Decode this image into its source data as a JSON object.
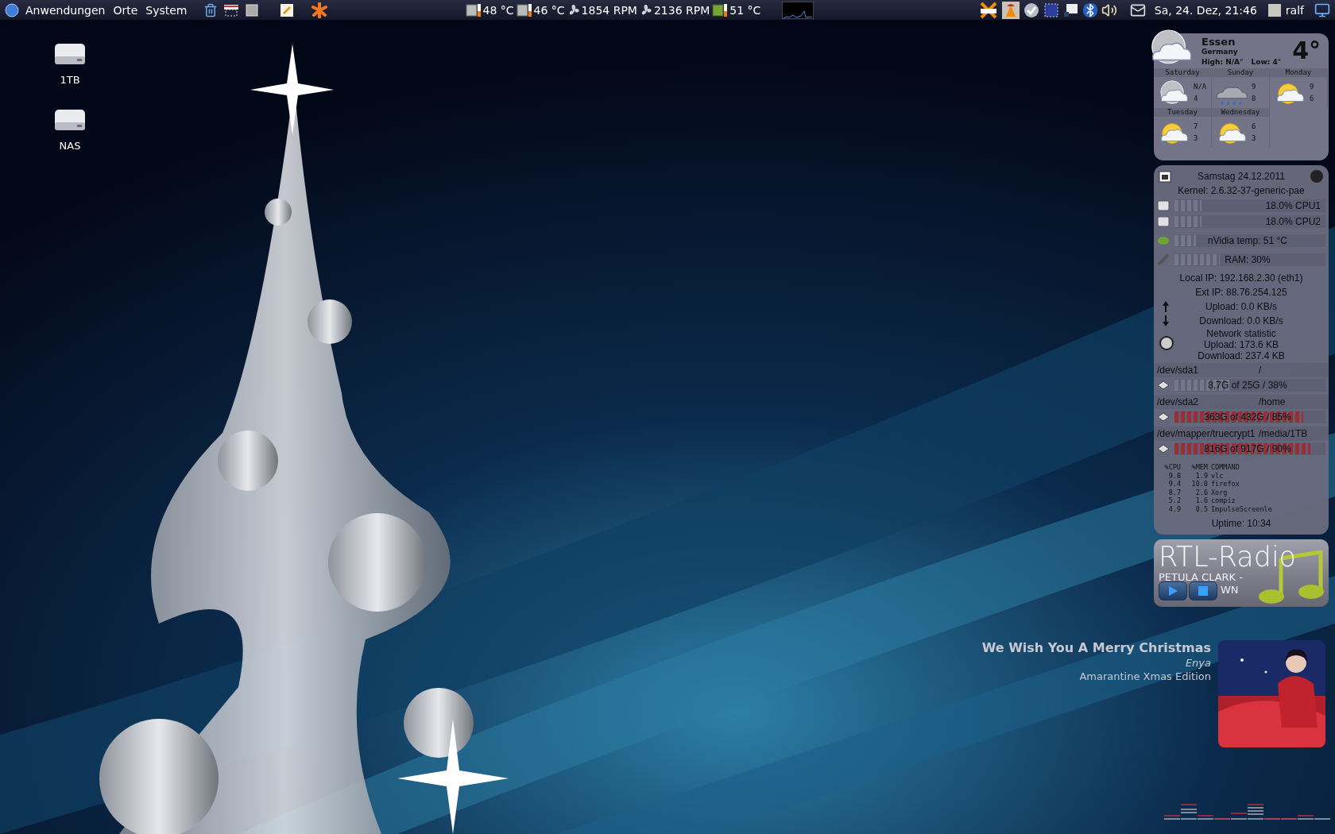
{
  "top_panel": {
    "menus": [
      "Anwendungen",
      "Orte",
      "System"
    ],
    "sensors": [
      {
        "kind": "chip",
        "reading": "48 °C"
      },
      {
        "kind": "chip",
        "reading": "46 °C"
      },
      {
        "kind": "fan",
        "reading": "1854 RPM"
      },
      {
        "kind": "fan",
        "reading": "2136 RPM"
      },
      {
        "kind": "gpu",
        "reading": "51 °C"
      }
    ],
    "clock": "Sa, 24. Dez, 21:46",
    "user": "ralf"
  },
  "desktop_icons": [
    "1TB",
    "NAS"
  ],
  "weather": {
    "city": "Essen",
    "country": "Germany",
    "high": "High: N/A°",
    "low": "Low: 4°",
    "temperature": "4°",
    "forecast": [
      {
        "day": "Saturday",
        "kind": "night",
        "high": "N/A",
        "low": "4"
      },
      {
        "day": "Sunday",
        "kind": "rain",
        "high": "9",
        "low": "8"
      },
      {
        "day": "Monday",
        "kind": "sun",
        "high": "9",
        "low": "6"
      },
      {
        "day": "Tuesday",
        "kind": "sun",
        "high": "7",
        "low": "3"
      },
      {
        "day": "Wednesday",
        "kind": "sun",
        "high": "6",
        "low": "3"
      }
    ]
  },
  "system_monitor": {
    "date": "Samstag 24.12.2011",
    "kernel": "Kernel: 2.6.32-37-generic-pae",
    "bars": [
      {
        "kind": "cpu",
        "label": "18.0% CPU1",
        "level": 0.18
      },
      {
        "kind": "cpu",
        "label": "18.0% CPU2",
        "level": 0.18
      },
      {
        "kind": "gpu",
        "label": "nVidia temp: 51 °C",
        "level": 0.14
      },
      {
        "kind": "ram",
        "label": "RAM: 30%",
        "level": 0.3
      }
    ],
    "local_ip": "Local IP: 192.168.2.30 (eth1)",
    "ext_ip": "Ext IP: 88.76.254.125",
    "upload": "Upload: 0.0 KB/s",
    "download": "Download: 0.0 KB/s",
    "statistic": [
      "Network statistic",
      "Upload: 173.6 KB",
      "Download: 237.4 KB"
    ],
    "disks": [
      {
        "device": "/dev/sda1",
        "mount": "/",
        "usage": "8,7G of 25G / 38%",
        "level": 0.38,
        "full": false
      },
      {
        "device": "/dev/sda2",
        "mount": "/home",
        "usage": "363G of 432G / 85%",
        "level": 0.85,
        "full": true
      },
      {
        "device": "/dev/mapper/truecrypt1",
        "mount": "/media/1TB",
        "usage": "816G of 917G / 90%",
        "level": 0.9,
        "full": true
      }
    ],
    "process_columns": [
      "%CPU",
      "%MEM",
      "COMMAND"
    ],
    "processes": [
      [
        "9.8",
        "1.9",
        "vlc"
      ],
      [
        "9.4",
        "10.0",
        "firefox"
      ],
      [
        "8.7",
        "2.6",
        "Xorg"
      ],
      [
        "5.2",
        "1.6",
        "compiz"
      ],
      [
        "4.9",
        "0.5",
        "ImpulseScreenle"
      ]
    ],
    "uptime": "Uptime: 10:34"
  },
  "radio": {
    "station": "RTL-Radio",
    "track": "PETULA CLARK  -",
    "track_rest": "WN"
  },
  "now_playing": {
    "title": "We Wish You A Merry Christmas",
    "artist": "Enya",
    "album": "Amarantine Xmas Edition"
  }
}
